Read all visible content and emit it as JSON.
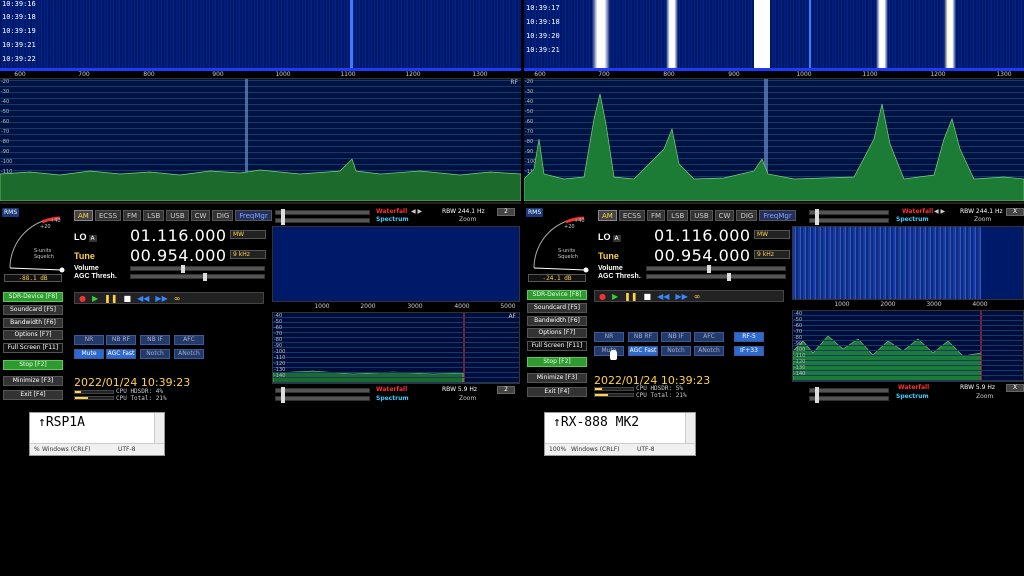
{
  "colors": {
    "waterfall_bg": "#001a6a",
    "spectrum_fill": "#2fa02f",
    "accent_yellow": "#ffd24a",
    "active_green": "#2f9a2f",
    "tune_blue": "#2d6ad0",
    "rf_red": "#ff3030",
    "spectrum_cyan": "#3cd0ff"
  },
  "left": {
    "timestamps": [
      "10:39:16",
      "10:39:18",
      "10:39:19",
      "10:39:21",
      "10:39:22"
    ],
    "freq_ticks": [
      "600",
      "700",
      "800",
      "900",
      "1000",
      "1100",
      "1200",
      "1300"
    ],
    "rf_tag": "RF",
    "db_labels": [
      "-20",
      "-30",
      "-40",
      "-50",
      "-60",
      "-70",
      "-80",
      "-90",
      "-100",
      "-110",
      "-120"
    ],
    "rms": "RMS",
    "smeter_db": "-88.1 dB",
    "smeter_label": "S-units\nSquelch",
    "modes": [
      "AM",
      "ECSS",
      "FM",
      "LSB",
      "USB",
      "CW",
      "DIG"
    ],
    "freqmgr": "FreqMgr",
    "lo_label": "LO",
    "lo_a": "A",
    "lo_freq": "01.116.000",
    "lo_band": "MW",
    "tune_label": "Tune",
    "tune_freq": "00.954.000",
    "tune_step": "9 kHz",
    "volume_label": "Volume",
    "agc_label": "AGC Thresh.",
    "side_buttons": [
      "SDR-Device [F8]",
      "Soundcard [F5]",
      "Bandwidth [F6]",
      "Options [F7]",
      "Full Screen [F11]",
      "Stop [F2]",
      "Minimize [F3]",
      "Exit [F4]"
    ],
    "dsp_row1": [
      "NR",
      "NB RF",
      "NB IF",
      "AFC"
    ],
    "dsp_row2": [
      "Mute",
      "AGC Fast",
      "Notch",
      "ANotch"
    ],
    "datetime": "2022/01/24 10:39:23",
    "cpu_hdsdr": "CPU HDSDR:  4%",
    "cpu_total": "CPU Total: 21%",
    "waterfall_label": "Waterfall",
    "spectrum_label": "Spectrum",
    "rbw_top": "RBW 244.1 Hz",
    "rbw_bottom": "RBW 5.9 Hz",
    "zoom_label": "Zoom",
    "num_top": "2",
    "num_bottom": "2",
    "af_ticks": [
      "1000",
      "2000",
      "3000",
      "4000",
      "5000"
    ],
    "af_tag": "AF",
    "af_db": [
      "-40",
      "-50",
      "-60",
      "-70",
      "-80",
      "-90",
      "-100",
      "-110",
      "-120",
      "-130",
      "-140"
    ]
  },
  "right": {
    "timestamps": [
      "10:39:17",
      "10:39:18",
      "10:39:20",
      "10:39:21"
    ],
    "freq_ticks": [
      "600",
      "700",
      "800",
      "900",
      "1000",
      "1100",
      "1200",
      "1300"
    ],
    "db_labels": [
      "-20",
      "-30",
      "-40",
      "-50",
      "-60",
      "-70",
      "-80",
      "-90",
      "-100",
      "-110",
      "-120"
    ],
    "rms": "RMS",
    "smeter_db": "-24.1 dB",
    "smeter_label": "S-units\nSquelch",
    "modes": [
      "AM",
      "ECSS",
      "FM",
      "LSB",
      "USB",
      "CW",
      "DIG"
    ],
    "freqmgr": "FreqMgr",
    "lo_label": "LO",
    "lo_a": "A",
    "lo_freq": "01.116.000",
    "lo_band": "MW",
    "tune_label": "Tune",
    "tune_freq": "00.954.000",
    "tune_step": "9 kHz",
    "volume_label": "Volume",
    "agc_label": "AGC Thresh.",
    "side_buttons": [
      "SDR-Device [F8]",
      "Soundcard [F5]",
      "Bandwidth [F6]",
      "Options [F7]",
      "Full Screen [F11]",
      "Stop [F2]",
      "Minimize [F3]",
      "Exit [F4]"
    ],
    "dsp_row1": [
      "NR",
      "NB RF",
      "NB IF",
      "AFC",
      "RF-5"
    ],
    "dsp_row2": [
      "Mute",
      "AGC Fast",
      "Notch",
      "ANotch",
      "IF+33"
    ],
    "datetime": "2022/01/24 10:39:23",
    "cpu_hdsdr": "CPU HDSDR:  5%",
    "cpu_total": "CPU Total: 21%",
    "waterfall_label": "Waterfall",
    "spectrum_label": "Spectrum",
    "rbw_top": "RBW 244.1 Hz",
    "rbw_bottom": "RBW 5.9 Hz",
    "zoom_label": "Zoom",
    "num_top": "X",
    "num_bottom": "X",
    "af_ticks": [
      "1000",
      "2000",
      "3000",
      "4000"
    ],
    "af_db": [
      "-40",
      "-50",
      "-60",
      "-70",
      "-80",
      "-90",
      "-100",
      "-110",
      "-120",
      "-130",
      "-140"
    ]
  },
  "notepad_left": {
    "text": "↑RSP1A",
    "status_zoom": "%",
    "status_eol": "Windows (CRLF)",
    "status_enc": "UTF-8"
  },
  "notepad_right": {
    "text": "↑RX-888 MK2",
    "status_zoom": "100%",
    "status_eol": "Windows (CRLF)",
    "status_enc": "UTF-8"
  }
}
